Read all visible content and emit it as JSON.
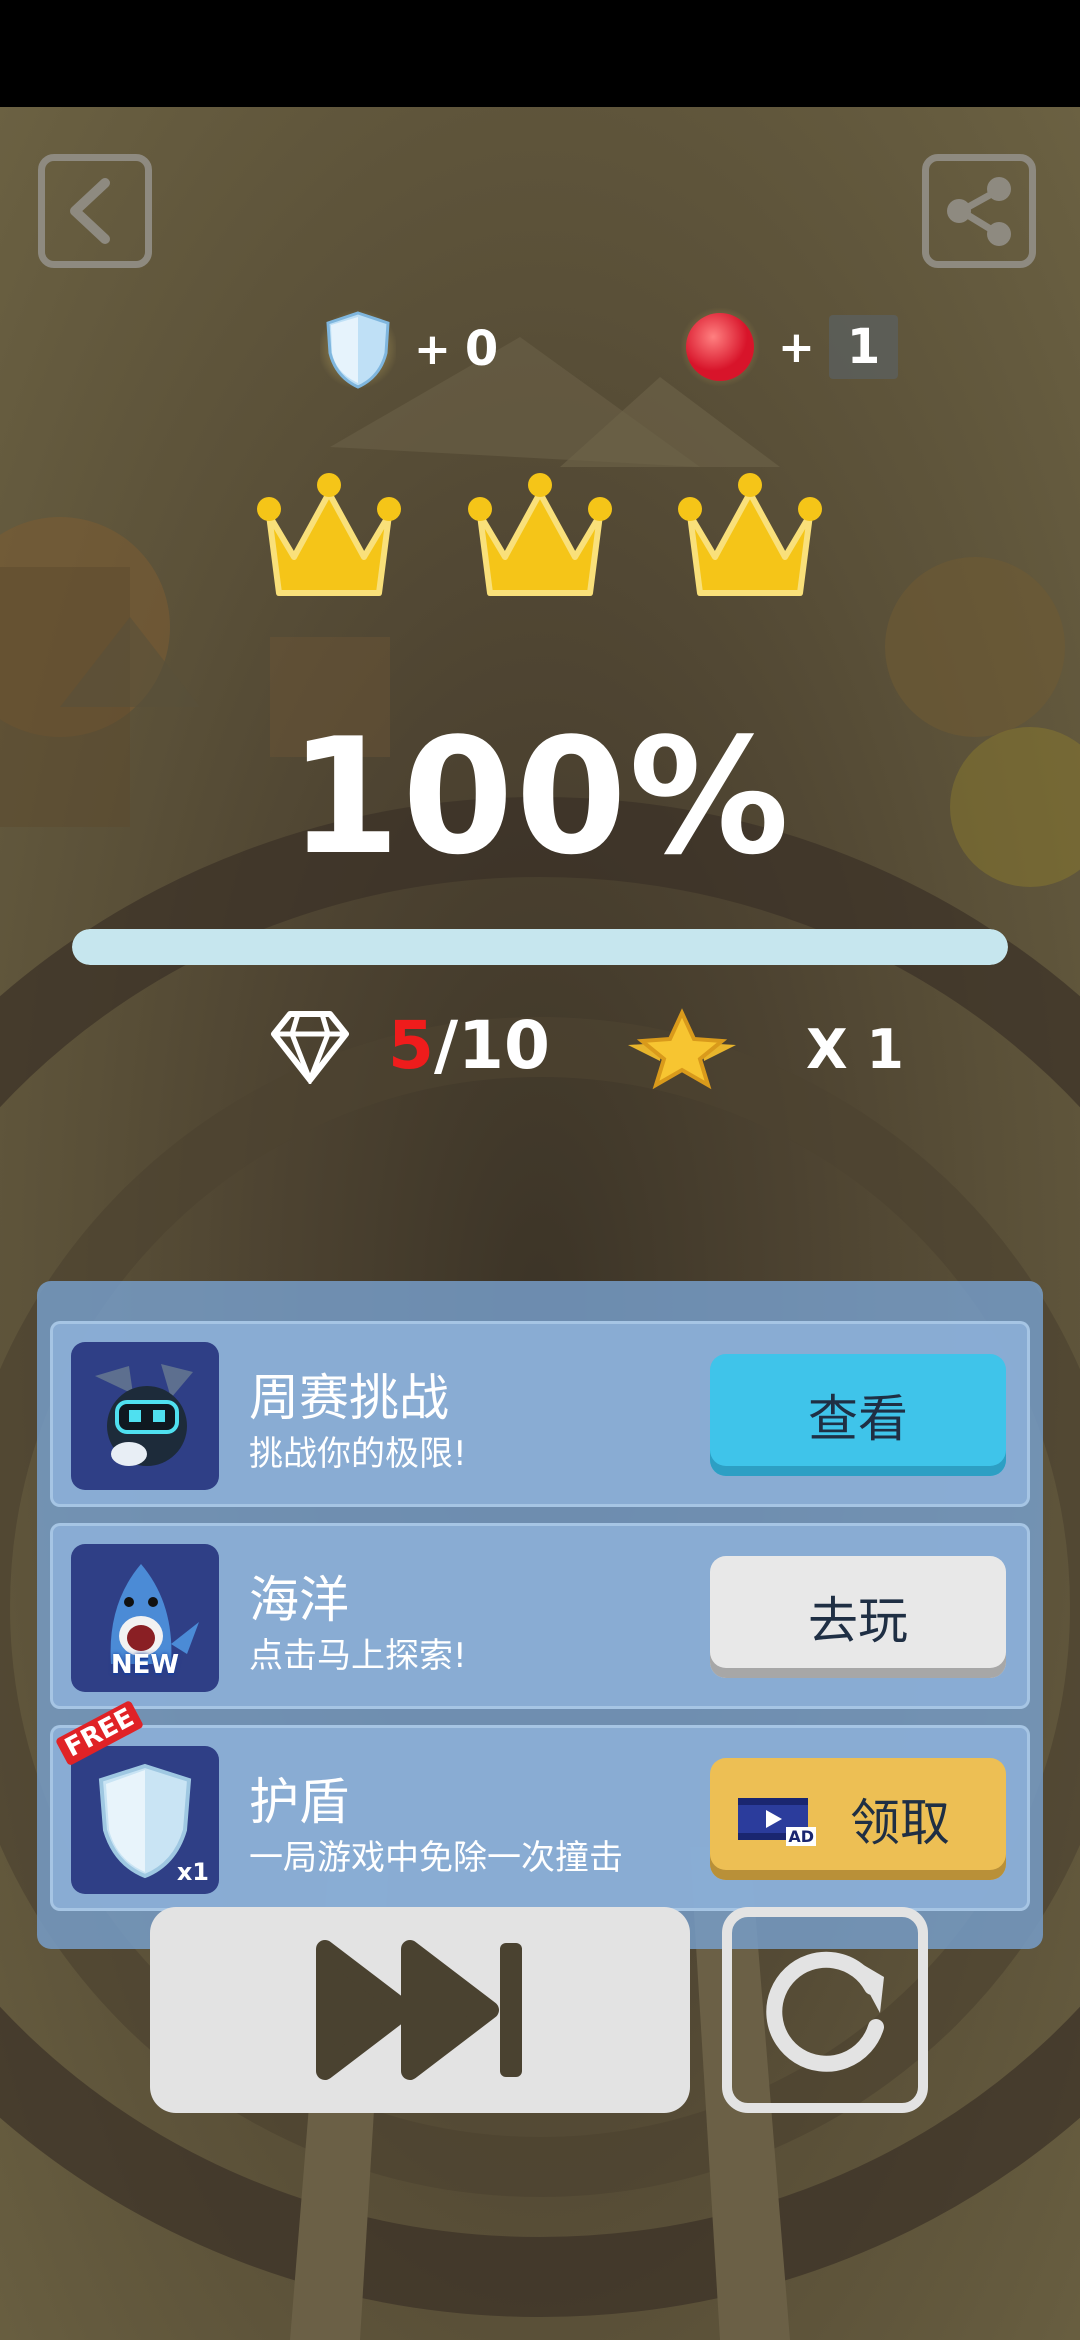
{
  "rewards": {
    "shield": {
      "plus": "+",
      "value": "0"
    },
    "ball": {
      "plus": "+",
      "value": "1"
    }
  },
  "result": {
    "percent": "100%",
    "progress": 1.0,
    "crowns": 3
  },
  "stats": {
    "gems_collected": "5",
    "gems_separator": "/",
    "gems_total": "10",
    "stars_label": "X 1"
  },
  "offers": [
    {
      "title": "周赛挑战",
      "subtitle": "挑战你的极限!",
      "button": "查看"
    },
    {
      "title": "海洋",
      "subtitle": "点击马上探索!",
      "button": "去玩",
      "badge": "NEW"
    },
    {
      "title": "护盾",
      "subtitle": "一局游戏中免除一次撞击",
      "button": "领取",
      "badge": "FREE",
      "count": "x1",
      "ad_label": "AD"
    }
  ],
  "colors": {
    "accent_blue": "#3fc4ea",
    "accent_gold": "#edbf54",
    "gem_count_red": "#ef1c1c",
    "crown_gold": "#f5c518"
  },
  "icons": [
    "back-icon",
    "share-icon",
    "shield-icon",
    "red-ball-icon",
    "crown-icon",
    "diamond-icon",
    "star-badge-icon",
    "skip-icon",
    "restart-icon",
    "video-ad-icon"
  ]
}
